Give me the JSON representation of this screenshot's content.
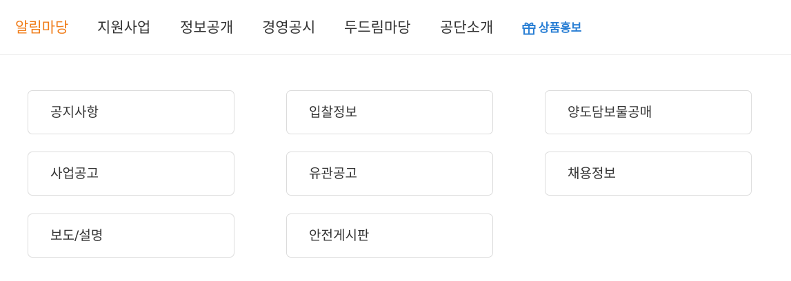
{
  "nav": {
    "items": [
      {
        "label": "알림마당",
        "active": true
      },
      {
        "label": "지원사업"
      },
      {
        "label": "정보공개"
      },
      {
        "label": "경영공시"
      },
      {
        "label": "두드림마당"
      },
      {
        "label": "공단소개"
      }
    ],
    "promo": {
      "label": "상품홍보",
      "icon": "gift-icon",
      "color": "#2a7fd4"
    },
    "active_color": "#f07d1a"
  },
  "submenu": {
    "items": [
      {
        "label": "공지사항"
      },
      {
        "label": "입찰정보"
      },
      {
        "label": "양도담보물공매"
      },
      {
        "label": "사업공고"
      },
      {
        "label": "유관공고"
      },
      {
        "label": "채용정보"
      },
      {
        "label": "보도/설명"
      },
      {
        "label": "안전게시판"
      }
    ]
  }
}
